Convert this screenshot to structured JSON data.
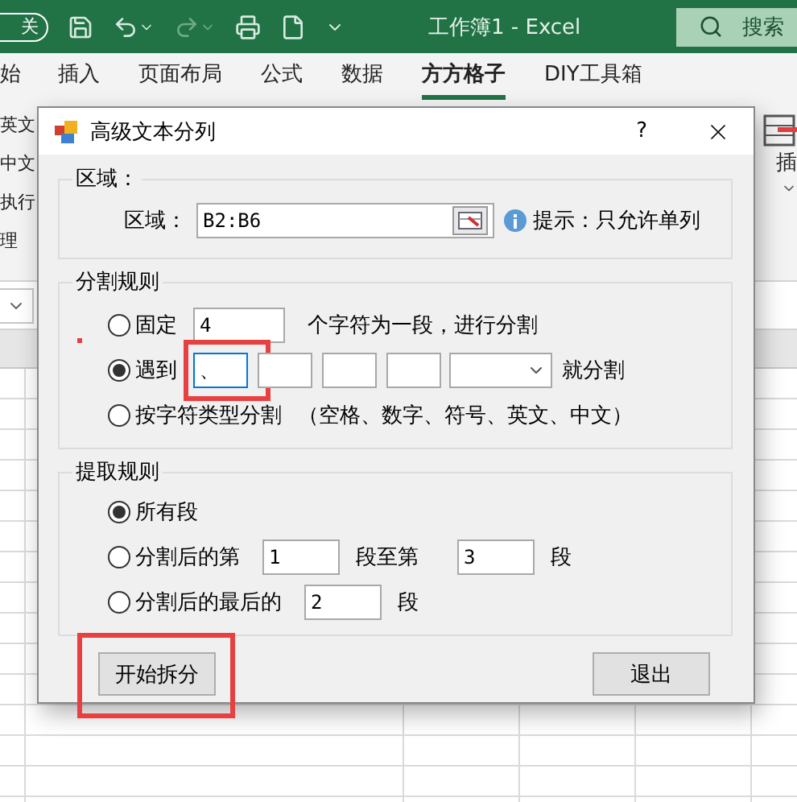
{
  "excel": {
    "autosave_label": "关",
    "title": "工作簿1 - Excel",
    "search_placeholder": "搜索",
    "ribbon_tabs": [
      {
        "label": "始",
        "selected": false
      },
      {
        "label": "插入",
        "selected": false
      },
      {
        "label": "页面布局",
        "selected": false
      },
      {
        "label": "公式",
        "selected": false
      },
      {
        "label": "数据",
        "selected": false
      },
      {
        "label": "方方格子",
        "selected": true
      },
      {
        "label": "DIY工具箱",
        "selected": false
      }
    ],
    "ribbon_left_items": [
      "英文",
      "中文",
      "执行",
      "理"
    ],
    "ribbon_right_item": "插"
  },
  "dialog": {
    "title": "高级文本分列",
    "help": "?",
    "region": {
      "legend": "区域：",
      "label": "区域：",
      "value": "B2:B6",
      "hint": "提示：只允许单列"
    },
    "split_rules": {
      "legend": "分割规则",
      "options": [
        {
          "kind": "fixed",
          "selected": false,
          "label": "固定",
          "value": "4",
          "suffix": "个字符为一段，进行分割"
        },
        {
          "kind": "delimiter",
          "selected": true,
          "label": "遇到",
          "fields": [
            {
              "value": "、",
              "focused": true,
              "highlighted": true
            },
            {
              "focused": false,
              "highlighted": false
            },
            {
              "focused": false,
              "highlighted": false
            },
            {
              "focused": false,
              "highlighted": false
            }
          ],
          "suffix": "就分割"
        },
        {
          "kind": "by_type",
          "selected": false,
          "label": "按字符类型分割",
          "note": "（空格、数字、符号、英文、中文）"
        }
      ]
    },
    "extract_rules": {
      "legend": "提取规则",
      "options": [
        {
          "kind": "all",
          "selected": true,
          "label": "所有段"
        },
        {
          "kind": "range",
          "selected": false,
          "label": "分割后的第",
          "from": "1",
          "middle": "段至第",
          "to": "3",
          "suffix": "段"
        },
        {
          "kind": "last",
          "selected": false,
          "label": "分割后的最后的",
          "value": "2",
          "suffix": "段"
        }
      ]
    },
    "buttons": [
      {
        "label": "开始拆分",
        "highlighted": true
      },
      {
        "label": "退出",
        "highlighted": false
      }
    ]
  }
}
